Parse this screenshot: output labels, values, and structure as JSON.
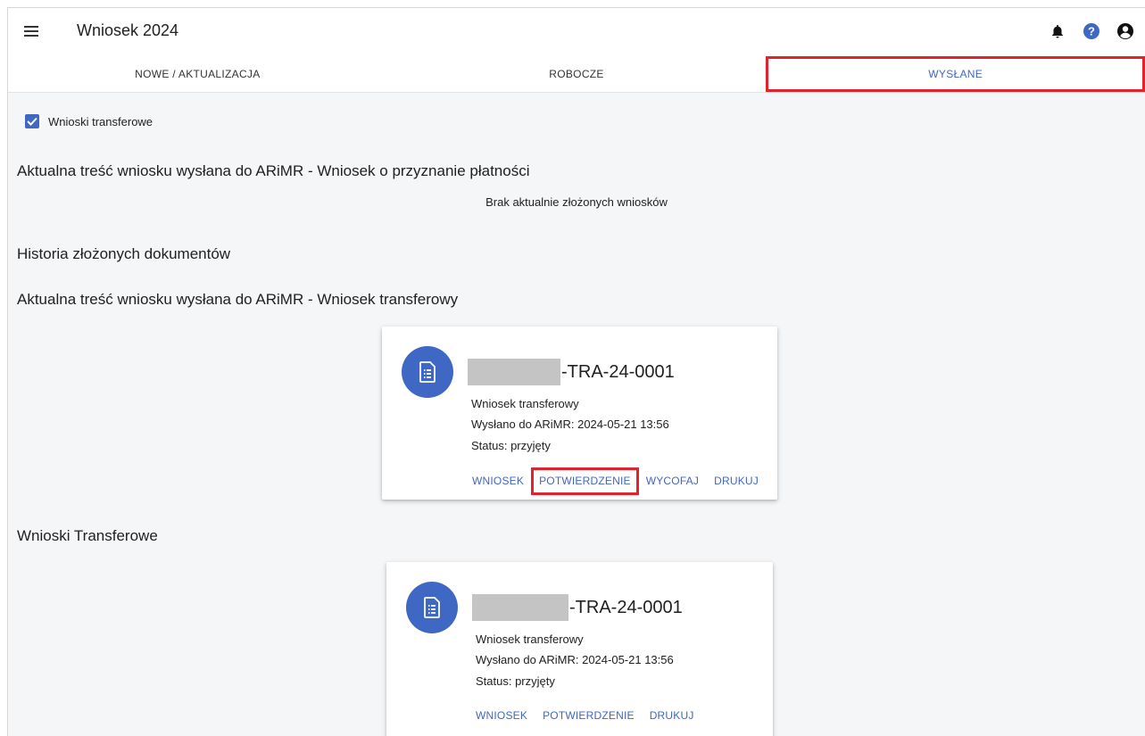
{
  "header": {
    "title": "Wniosek 2024",
    "icons": [
      "menu-icon",
      "bell-icon",
      "help-icon",
      "account-icon"
    ]
  },
  "tabs": [
    {
      "label": "NOWE / AKTUALIZACJA"
    },
    {
      "label": "ROBOCZE"
    },
    {
      "label": "WYSŁANE",
      "active": true
    }
  ],
  "filter": {
    "label": "Wnioski transferowe",
    "checked": true
  },
  "sections": {
    "payment_title": "Aktualna treść wniosku wysłana do ARiMR - Wniosek o przyznanie płatności",
    "payment_empty": "Brak aktualnie złożonych wniosków",
    "history_title": "Historia złożonych dokumentów",
    "transfer_title": "Aktualna treść wniosku wysłana do ARiMR - Wniosek transferowy",
    "transfers_title": "Wnioski Transferowe"
  },
  "cards": [
    {
      "number_suffix": "-TRA-24-0001",
      "type": "Wniosek transferowy",
      "sent": "Wysłano do ARiMR: 2024-05-21 13:56",
      "status": "Status: przyjęty",
      "actions": [
        "WNIOSEK",
        "POTWIERDZENIE",
        "WYCOFAJ",
        "DRUKUJ"
      ]
    },
    {
      "number_suffix": "-TRA-24-0001",
      "type": "Wniosek transferowy",
      "sent": "Wysłano do ARiMR: 2024-05-21 13:56",
      "status": "Status: przyjęty",
      "actions": [
        "WNIOSEK",
        "POTWIERDZENIE",
        "DRUKUJ"
      ]
    }
  ],
  "colors": {
    "accent": "#3f67c4",
    "highlight": "#e0232d",
    "background": "#f5f6f8"
  }
}
